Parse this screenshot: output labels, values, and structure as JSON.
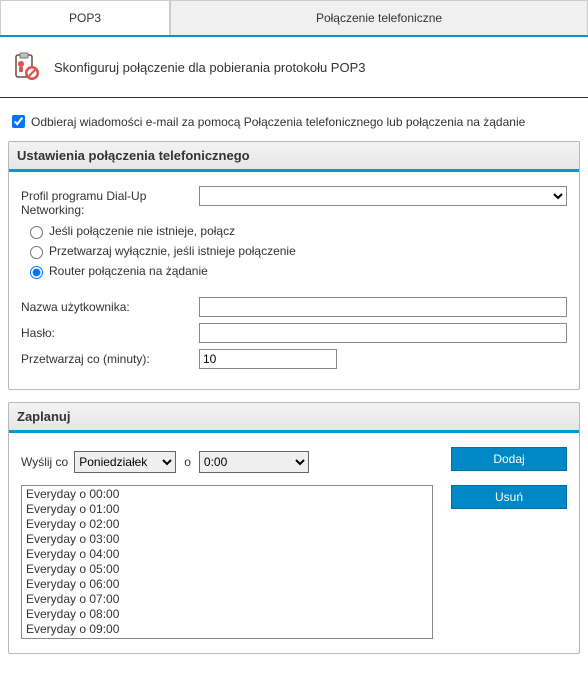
{
  "tabs": {
    "pop3": "POP3",
    "dialup": "Połączenie telefoniczne"
  },
  "header": {
    "text": "Skonfiguruj połączenie dla pobierania protokołu POP3"
  },
  "receive_checkbox": {
    "label": "Odbieraj wiadomości e-mail za pomocą Połączenia telefonicznego lub połączenia na żądanie"
  },
  "dialup_section": {
    "title": "Ustawienia połączenia telefonicznego",
    "profile_label": "Profil programu Dial-Up Networking:",
    "radio1": "Jeśli połączenie nie istnieje, połącz",
    "radio2": "Przetwarzaj wyłącznie, jeśli istnieje połączenie",
    "radio3": "Router połączenia na żądanie",
    "user_label": "Nazwa użytkownika:",
    "pass_label": "Hasło:",
    "interval_label": "Przetwarzaj co (minuty):",
    "interval_value": "10"
  },
  "schedule_section": {
    "title": "Zaplanuj",
    "send_label": "Wyślij co",
    "day_value": "Poniedziałek",
    "at_label": "o",
    "time_value": "0:00",
    "add_btn": "Dodaj",
    "del_btn": "Usuń",
    "items": [
      "Everyday o 00:00",
      "Everyday o 01:00",
      "Everyday o 02:00",
      "Everyday o 03:00",
      "Everyday o 04:00",
      "Everyday o 05:00",
      "Everyday o 06:00",
      "Everyday o 07:00",
      "Everyday o 08:00",
      "Everyday o 09:00"
    ]
  }
}
